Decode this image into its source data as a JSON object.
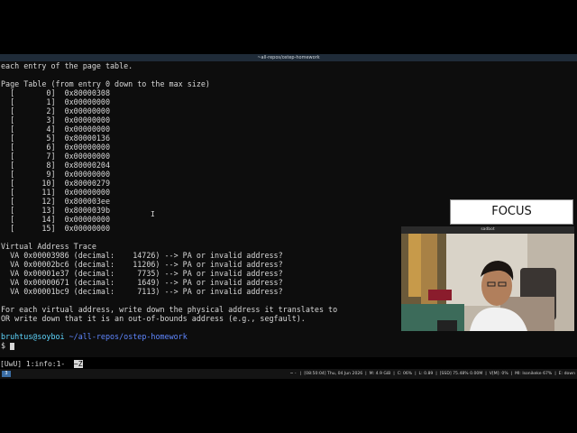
{
  "window": {
    "title": "~all-repos/ostep-homework"
  },
  "terminal": {
    "lines": [
      "each entry of the page table.",
      "",
      "Page Table (from entry 0 down to the max size)",
      "  [       0]  0x80000308",
      "  [       1]  0x00000000",
      "  [       2]  0x00000000",
      "  [       3]  0x00000000",
      "  [       4]  0x00000000",
      "  [       5]  0x80000136",
      "  [       6]  0x00000000",
      "  [       7]  0x00000000",
      "  [       8]  0x80000204",
      "  [       9]  0x00000000",
      "  [      10]  0x80000279",
      "  [      11]  0x00000000",
      "  [      12]  0x800003ee",
      "  [      13]  0x8000039b",
      "  [      14]  0x00000000",
      "  [      15]  0x00000000",
      "",
      "Virtual Address Trace",
      "  VA 0x00003986 (decimal:    14726) --> PA or invalid address?",
      "  VA 0x00002bc6 (decimal:    11206) --> PA or invalid address?",
      "  VA 0x00001e37 (decimal:     7735) --> PA or invalid address?",
      "  VA 0x00000671 (decimal:     1649) --> PA or invalid address?",
      "  VA 0x00001bc9 (decimal:     7113) --> PA or invalid address?",
      "",
      "For each virtual address, write down the physical address it translates to",
      "OR write down that it is an out-of-bounds address (e.g., segfault)."
    ],
    "prompt": {
      "user": "bruhtus@soyboi",
      "path": "~/all-repos/ostep-homework",
      "symbol": "$"
    }
  },
  "tmux": {
    "session": "[UwU] 1:info:1-",
    "active_window": "~Z"
  },
  "panel": {
    "workspace": "3",
    "status": "~ -   |  [08:50:04] Thu, 04 Jun 2026  |  M: 4.9 GiB  |  C: 06%  |  L: 0.89  |  [SSD] 75.48% 0.00M  |  V[M]: 0%  |  Ml: lsonikeke 67%  |  E: down"
  },
  "overlay": {
    "focus_label": "FOCUS",
    "webcam_title": "sadbot"
  },
  "colors": {
    "titlebar": "#1f2b38",
    "terminal_bg": "#0d0d0d",
    "prompt_user": "#5fd7ff",
    "prompt_path": "#5f87ff"
  }
}
